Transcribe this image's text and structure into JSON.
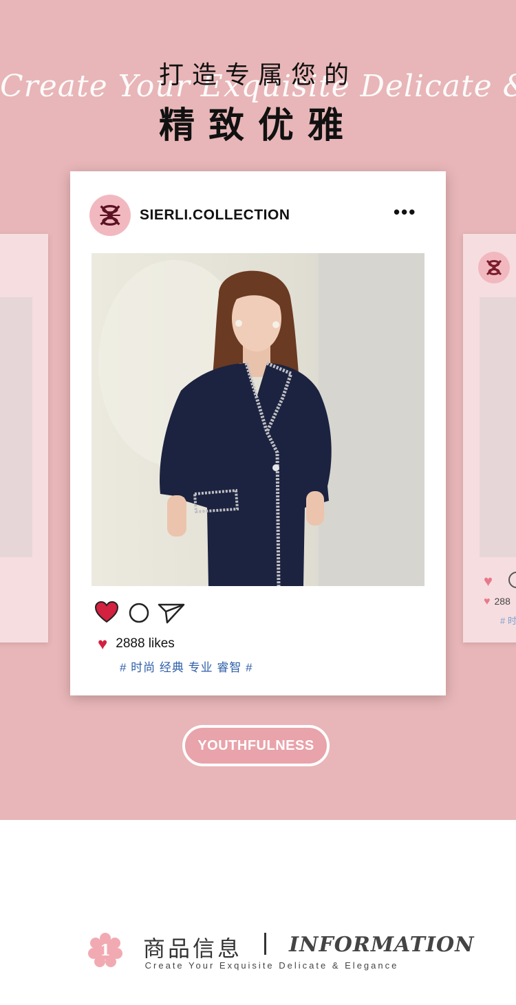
{
  "header": {
    "title_line1": "打造专属您的",
    "title_line2": "精致优雅",
    "script_text": "Create Your Exquisite Delicate & Elegance"
  },
  "post": {
    "username": "SIERLI.COLLECTION",
    "more_label": "•••",
    "likes_text": "2888 likes",
    "hashtags": "# 时尚 经典 专业 睿智 #"
  },
  "side_card_right": {
    "likes_partial": "288",
    "tag_partial": "# 时"
  },
  "badge": {
    "label": "YOUTHFULNESS"
  },
  "info_section": {
    "number": "1",
    "title_cn": "商品信息",
    "title_en": "INFORMATION",
    "subtitle": "Create Your Exquisite Delicate & Elegance"
  },
  "colors": {
    "background_pink": "#e8b6b8",
    "heart_red": "#d32140",
    "hashtag_blue": "#2e5ea8",
    "avatar_pink": "#f2b8bf"
  },
  "icons": [
    "brand-logo-icon",
    "more-icon",
    "heart-icon",
    "comment-icon",
    "share-icon",
    "flower-number-icon"
  ]
}
